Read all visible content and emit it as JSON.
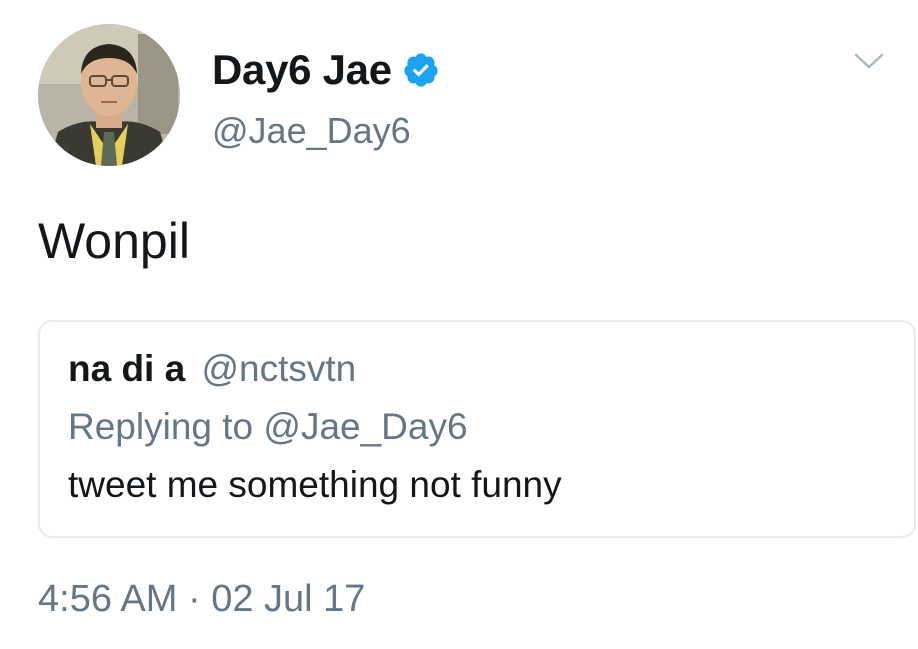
{
  "tweet": {
    "author": {
      "name": "Day6 Jae",
      "handle": "@Jae_Day6",
      "verified": true
    },
    "text": "Wonpil",
    "quote": {
      "author_name": "na di a",
      "author_handle": "@nctsvtn",
      "replying_label": "Replying to",
      "replying_to": "@Jae_Day6",
      "text": "tweet me something not funny"
    },
    "time": "4:56 AM",
    "separator": "·",
    "date": "02 Jul 17"
  },
  "colors": {
    "primary_text": "#14171a",
    "secondary_text": "#657786",
    "verified_blue": "#1da1f2",
    "border": "#e6ecf0"
  },
  "icons": [
    "verified-badge-icon",
    "chevron-down-icon"
  ]
}
